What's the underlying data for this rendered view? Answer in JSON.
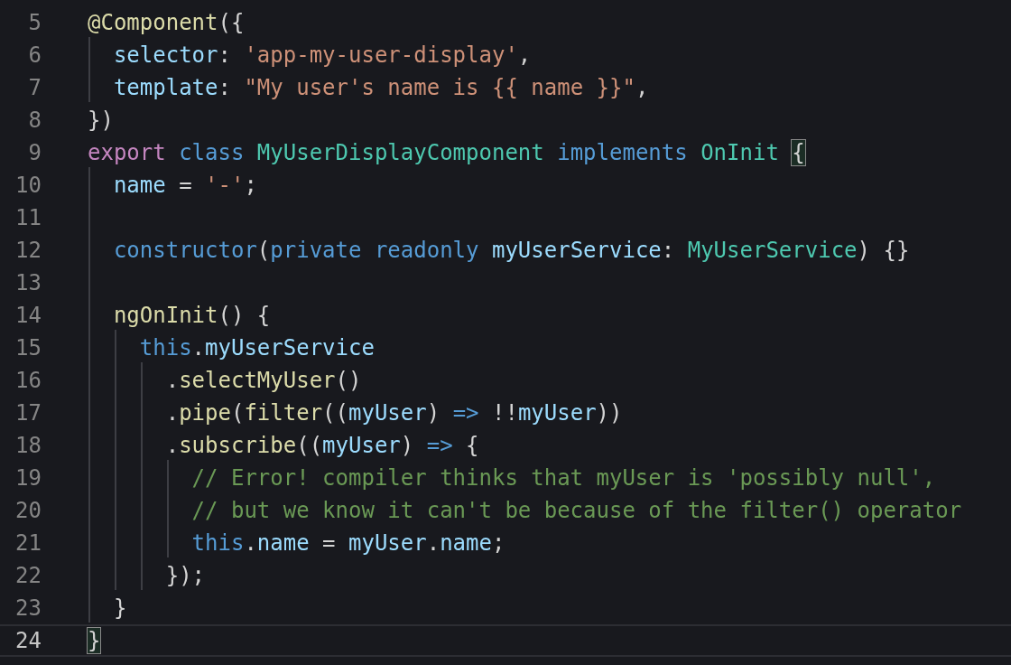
{
  "editor": {
    "lines": [
      {
        "number": "5",
        "current": false,
        "tokens": [
          {
            "text": "@Component",
            "kind": "func"
          },
          {
            "text": "({",
            "kind": "punct"
          }
        ]
      },
      {
        "number": "6",
        "current": false,
        "tokens": [
          {
            "text": "  selector",
            "kind": "var"
          },
          {
            "text": ": ",
            "kind": "punct"
          },
          {
            "text": "'app-my-user-display'",
            "kind": "string"
          },
          {
            "text": ",",
            "kind": "punct"
          }
        ]
      },
      {
        "number": "7",
        "current": false,
        "tokens": [
          {
            "text": "  template",
            "kind": "var"
          },
          {
            "text": ": ",
            "kind": "punct"
          },
          {
            "text": "\"My user's name is {{ name }}\"",
            "kind": "string"
          },
          {
            "text": ",",
            "kind": "punct"
          }
        ]
      },
      {
        "number": "8",
        "current": false,
        "tokens": [
          {
            "text": "})",
            "kind": "punct"
          }
        ]
      },
      {
        "number": "9",
        "current": false,
        "tokens": [
          {
            "text": "export",
            "kind": "keyword"
          },
          {
            "text": " class",
            "kind": "storage"
          },
          {
            "text": " MyUserDisplayComponent",
            "kind": "type"
          },
          {
            "text": " implements",
            "kind": "storage"
          },
          {
            "text": " OnInit ",
            "kind": "type"
          },
          {
            "text": "{",
            "kind": "punct",
            "matched": true
          }
        ]
      },
      {
        "number": "10",
        "current": false,
        "tokens": [
          {
            "text": "  name",
            "kind": "var"
          },
          {
            "text": " = ",
            "kind": "punct"
          },
          {
            "text": "'-'",
            "kind": "string"
          },
          {
            "text": ";",
            "kind": "punct"
          }
        ]
      },
      {
        "number": "11",
        "current": false
      },
      {
        "number": "12",
        "current": false,
        "tokens": [
          {
            "text": "  constructor",
            "kind": "storage"
          },
          {
            "text": "(",
            "kind": "punct"
          },
          {
            "text": "private readonly",
            "kind": "storage"
          },
          {
            "text": " myUserService",
            "kind": "var"
          },
          {
            "text": ": ",
            "kind": "punct"
          },
          {
            "text": "MyUserService",
            "kind": "type"
          },
          {
            "text": ") {}",
            "kind": "punct"
          }
        ]
      },
      {
        "number": "13",
        "current": false
      },
      {
        "number": "14",
        "current": false,
        "tokens": [
          {
            "text": "  ngOnInit",
            "kind": "func"
          },
          {
            "text": "() {",
            "kind": "punct"
          }
        ]
      },
      {
        "number": "15",
        "current": false,
        "tokens": [
          {
            "text": "    this",
            "kind": "storage"
          },
          {
            "text": ".",
            "kind": "punct"
          },
          {
            "text": "myUserService",
            "kind": "var"
          }
        ]
      },
      {
        "number": "16",
        "current": false,
        "tokens": [
          {
            "text": "      .",
            "kind": "punct"
          },
          {
            "text": "selectMyUser",
            "kind": "func"
          },
          {
            "text": "()",
            "kind": "punct"
          }
        ]
      },
      {
        "number": "17",
        "current": false,
        "tokens": [
          {
            "text": "      .",
            "kind": "punct"
          },
          {
            "text": "pipe",
            "kind": "func"
          },
          {
            "text": "(",
            "kind": "punct"
          },
          {
            "text": "filter",
            "kind": "func"
          },
          {
            "text": "((",
            "kind": "punct"
          },
          {
            "text": "myUser",
            "kind": "var"
          },
          {
            "text": ") ",
            "kind": "punct"
          },
          {
            "text": "=>",
            "kind": "storage"
          },
          {
            "text": " !!",
            "kind": "punct"
          },
          {
            "text": "myUser",
            "kind": "var"
          },
          {
            "text": "))",
            "kind": "punct"
          }
        ]
      },
      {
        "number": "18",
        "current": false,
        "tokens": [
          {
            "text": "      .",
            "kind": "punct"
          },
          {
            "text": "subscribe",
            "kind": "func"
          },
          {
            "text": "((",
            "kind": "punct"
          },
          {
            "text": "myUser",
            "kind": "var"
          },
          {
            "text": ") ",
            "kind": "punct"
          },
          {
            "text": "=>",
            "kind": "storage"
          },
          {
            "text": " {",
            "kind": "punct"
          }
        ]
      },
      {
        "number": "19",
        "current": false,
        "tokens": [
          {
            "text": "        // Error! compiler thinks that myUser is 'possibly null',",
            "kind": "comment"
          }
        ]
      },
      {
        "number": "20",
        "current": false,
        "tokens": [
          {
            "text": "        // but we know it can't be because of the filter() operator",
            "kind": "comment"
          }
        ]
      },
      {
        "number": "21",
        "current": false,
        "tokens": [
          {
            "text": "        this",
            "kind": "storage"
          },
          {
            "text": ".",
            "kind": "punct"
          },
          {
            "text": "name",
            "kind": "var"
          },
          {
            "text": " = ",
            "kind": "punct"
          },
          {
            "text": "myUser",
            "kind": "var"
          },
          {
            "text": ".",
            "kind": "punct"
          },
          {
            "text": "name",
            "kind": "var"
          },
          {
            "text": ";",
            "kind": "punct"
          }
        ]
      },
      {
        "number": "22",
        "current": false,
        "tokens": [
          {
            "text": "      });",
            "kind": "punct"
          }
        ]
      },
      {
        "number": "23",
        "current": false,
        "tokens": [
          {
            "text": "  }",
            "kind": "punct"
          }
        ]
      },
      {
        "number": "24",
        "current": true,
        "tokens": [
          {
            "text": "}",
            "kind": "punct",
            "matched": true
          }
        ]
      }
    ]
  }
}
